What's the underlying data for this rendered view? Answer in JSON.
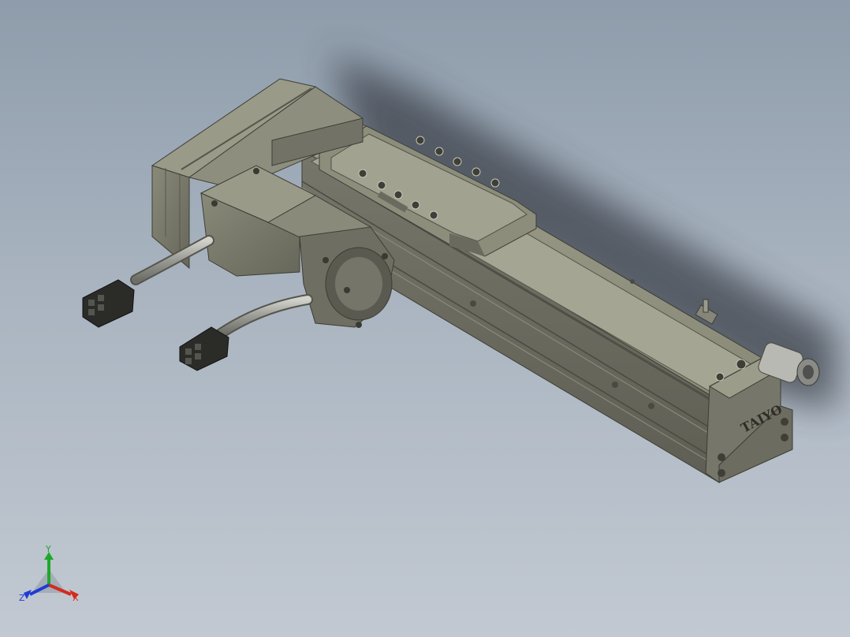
{
  "viewport": {
    "background_top": "#8e9cab",
    "background_bottom": "#c2c9d2"
  },
  "model": {
    "logo_text": "TAIYO",
    "body_color": "#7f7f6d",
    "body_dark": "#55554a",
    "body_light": "#a4a494",
    "cable_color": "#b0b0a8",
    "connector_color": "#2b2b28"
  },
  "triad": {
    "x_label": "X",
    "y_label": "Y",
    "z_label": "Z",
    "x_color": "#d42a1e",
    "y_color": "#1ea82a",
    "z_color": "#1e3cd4"
  }
}
